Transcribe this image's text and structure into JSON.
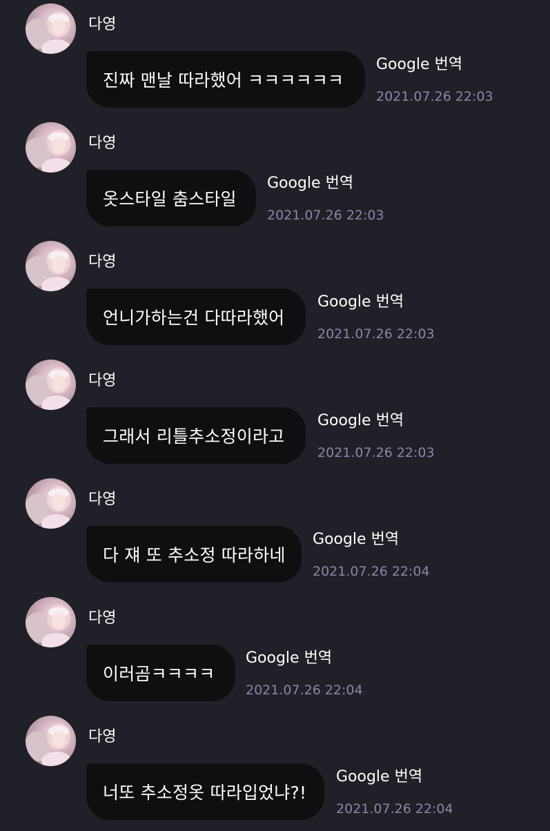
{
  "messages": [
    {
      "sender": "다영",
      "text": "진짜 맨날 따라했어 ㅋㅋㅋㅋㅋㅋ",
      "translate_label": "Google 번역",
      "time": "2021.07.26 22:03"
    },
    {
      "sender": "다영",
      "text": "옷스타일 춤스타일",
      "translate_label": "Google 번역",
      "time": "2021.07.26 22:03"
    },
    {
      "sender": "다영",
      "text": "언니가하는건 다따라했어",
      "translate_label": "Google 번역",
      "time": "2021.07.26 22:03"
    },
    {
      "sender": "다영",
      "text": "그래서 리틀추소정이라고",
      "translate_label": "Google 번역",
      "time": "2021.07.26 22:03"
    },
    {
      "sender": "다영",
      "text": "다 쟤 또 추소정 따라하네",
      "translate_label": "Google 번역",
      "time": "2021.07.26 22:04"
    },
    {
      "sender": "다영",
      "text": "이러곰ㅋㅋㅋㅋ",
      "translate_label": "Google 번역",
      "time": "2021.07.26 22:04"
    },
    {
      "sender": "다영",
      "text": "너또 추소정옷 따라입었냐?!",
      "translate_label": "Google 번역",
      "time": "2021.07.26 22:04"
    }
  ]
}
